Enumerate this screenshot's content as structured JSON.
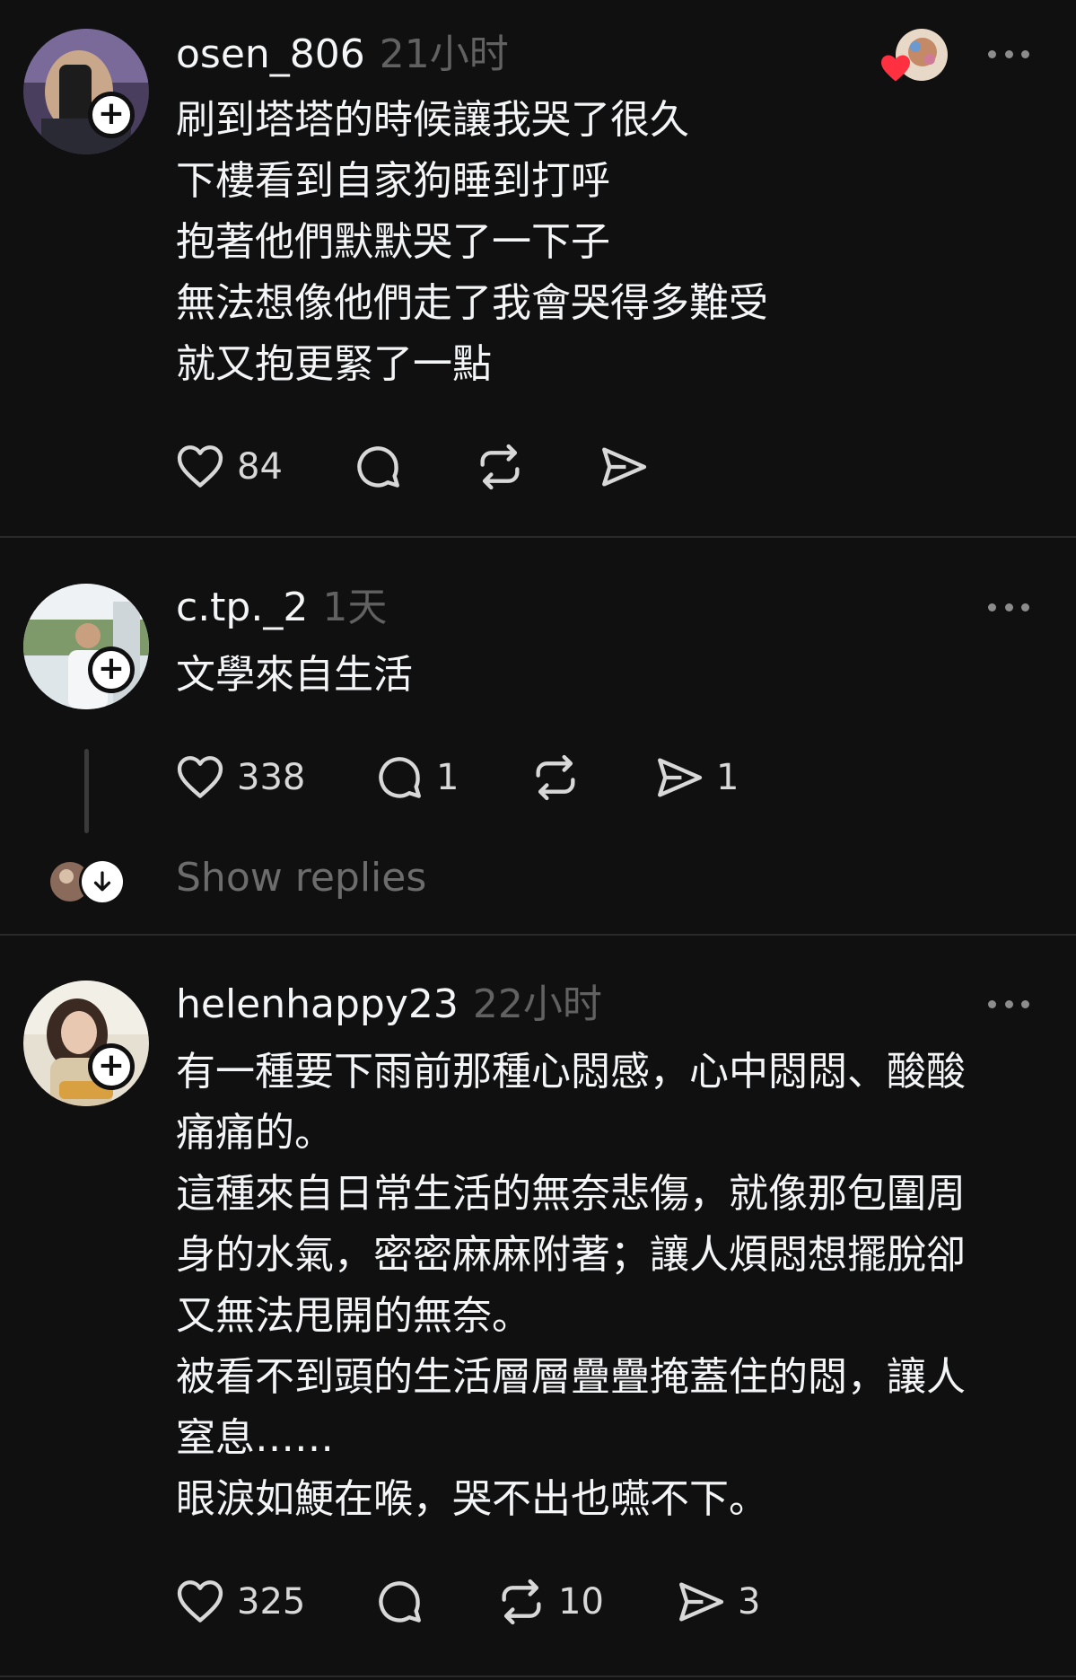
{
  "posts": [
    {
      "username": "osen_806",
      "time": "21小时",
      "content": "刷到塔塔的時候讓我哭了很久\n下樓看到自家狗睡到打呼\n抱著他們默默哭了一下子\n無法想像他們走了我會哭得多難受\n就又抱更緊了一點",
      "likes": "84",
      "replies": "",
      "reposts": "",
      "shares": "",
      "liked_by_author": true
    },
    {
      "username": "c.tp._2",
      "time": "1天",
      "content": "文學來自生活",
      "likes": "338",
      "replies": "1",
      "reposts": "",
      "shares": "1",
      "show_replies_label": "Show replies"
    },
    {
      "username": "helenhappy23",
      "time": "22小时",
      "content": "有一種要下雨前那種心悶感，心中悶悶、酸酸\n痛痛的。\n這種來自日常生活的無奈悲傷，就像那包圍周\n身的水氣，密密麻麻附著；讓人煩悶想擺脫卻\n又無法甩開的無奈。\n被看不到頭的生活層層疊疊掩蓋住的悶，讓人\n窒息……\n眼淚如鯁在喉，哭不出也嚥不下。",
      "likes": "325",
      "replies": "",
      "reposts": "10",
      "shares": "3"
    }
  ],
  "icons": {
    "like": "heart-icon",
    "reply": "comment-bubble-icon",
    "repost": "repost-icon",
    "share": "send-icon",
    "more": "more-options-icon",
    "follow": "plus-icon",
    "expand": "arrow-down-icon"
  },
  "colors": {
    "background": "#101010",
    "text": "#f3f5f7",
    "muted": "#616161",
    "heart": "#ff3040"
  }
}
